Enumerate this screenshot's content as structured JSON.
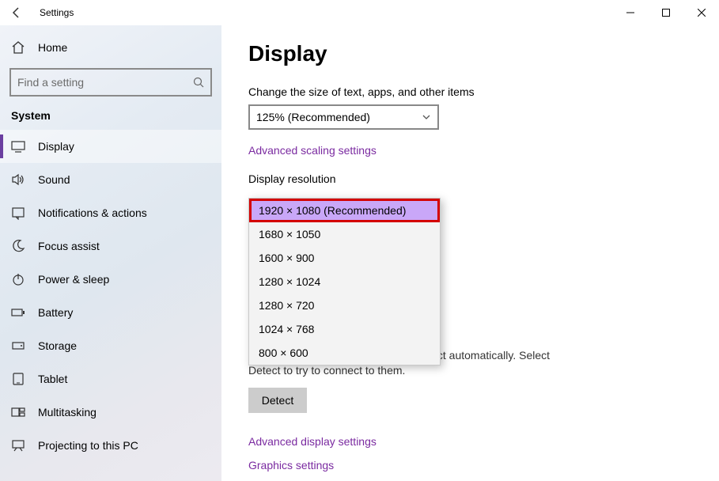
{
  "titlebar": {
    "app_name": "Settings"
  },
  "sidebar": {
    "home_label": "Home",
    "search_placeholder": "Find a setting",
    "section_title": "System",
    "items": [
      {
        "label": "Display"
      },
      {
        "label": "Sound"
      },
      {
        "label": "Notifications & actions"
      },
      {
        "label": "Focus assist"
      },
      {
        "label": "Power & sleep"
      },
      {
        "label": "Battery"
      },
      {
        "label": "Storage"
      },
      {
        "label": "Tablet"
      },
      {
        "label": "Multitasking"
      },
      {
        "label": "Projecting to this PC"
      }
    ]
  },
  "main": {
    "title": "Display",
    "scale_label": "Change the size of text, apps, and other items",
    "scale_value": "125% (Recommended)",
    "adv_scaling_link": "Advanced scaling settings",
    "resolution_label": "Display resolution",
    "resolution_options": [
      "1920 × 1080 (Recommended)",
      "1680 × 1050",
      "1600 × 900",
      "1280 × 1024",
      "1280 × 720",
      "1024 × 768",
      "800 × 600"
    ],
    "older_text": "Older displays might not always connect automatically. Select Detect to try to connect to them.",
    "detect_label": "Detect",
    "adv_display_link": "Advanced display settings",
    "graphics_link": "Graphics settings"
  }
}
